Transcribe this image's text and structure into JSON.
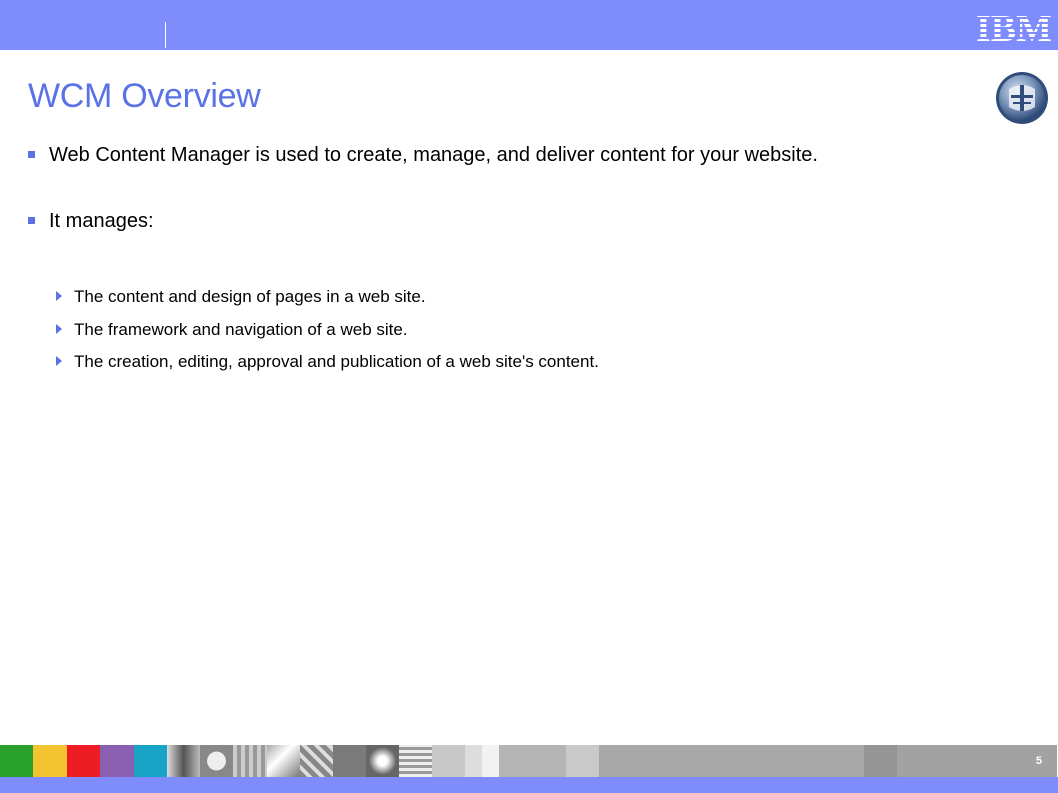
{
  "header": {
    "logo_text": "IBM",
    "brand_color": "#7f8dfc"
  },
  "slide": {
    "title": "WCM Overview",
    "accent_color": "#5a72e6",
    "bullets": [
      {
        "text": "Web Content Manager is used to create, manage, and deliver content for your website."
      },
      {
        "text": "It manages:"
      }
    ],
    "sub_bullets": [
      {
        "text": "The content and design of pages in a web site."
      },
      {
        "text": "The framework and navigation of a web site."
      },
      {
        "text": "The creation, editing, approval and publication of a web site's content."
      }
    ]
  },
  "footer": {
    "page_number": "5",
    "tile_colors": [
      "#2aa12a",
      "#f4c430",
      "#ee1c25",
      "#8a5eb0",
      "#17a4c6"
    ]
  },
  "icons": {
    "emblem": "globe-emblem-icon",
    "logo": "ibm-logo-icon"
  }
}
